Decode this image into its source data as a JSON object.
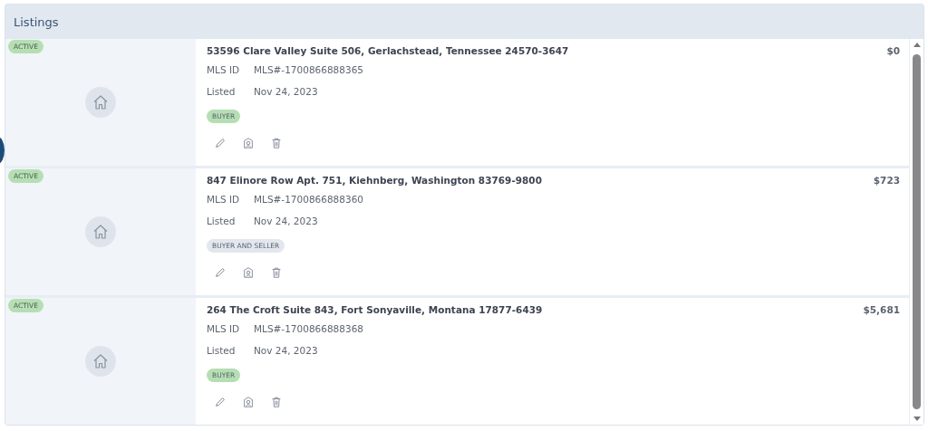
{
  "panel": {
    "title": "Listings"
  },
  "listings": [
    {
      "status": {
        "label": "ACTIVE",
        "color": "#b5dfb3"
      },
      "address": "53596 Clare Valley Suite 506, Gerlachstead, Tennessee 24570-3647",
      "price": "$0",
      "mls_label": "MLS ID",
      "mls_id": "MLS#-1700866888365",
      "listed_label": "Listed",
      "listed_date": "Nov 24, 2023",
      "role": {
        "label": "BUYER",
        "color": "#b5dfb3"
      }
    },
    {
      "status": {
        "label": "ACTIVE",
        "color": "#b5dfb3"
      },
      "address": "847 Elinore Row Apt. 751, Kiehnberg, Washington 83769-9800",
      "price": "$723",
      "mls_label": "MLS ID",
      "mls_id": "MLS#-1700866888360",
      "listed_label": "Listed",
      "listed_date": "Nov 24, 2023",
      "role": {
        "label": "BUYER AND SELLER",
        "color": "#e3e7ed"
      }
    },
    {
      "status": {
        "label": "ACTIVE",
        "color": "#b5dfb3"
      },
      "address": "264 The Croft Suite 843, Fort Sonyaville, Montana 17877-6439",
      "price": "$5,681",
      "mls_label": "MLS ID",
      "mls_id": "MLS#-1700866888368",
      "listed_label": "Listed",
      "listed_date": "Nov 24, 2023",
      "role": {
        "label": "BUYER",
        "color": "#b5dfb3"
      }
    }
  ]
}
